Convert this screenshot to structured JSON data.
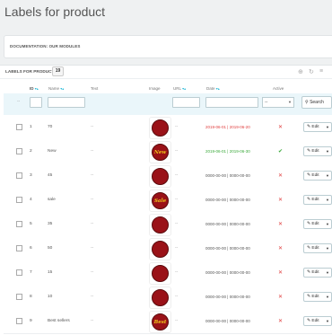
{
  "page": {
    "title": "Labels for product"
  },
  "doc_panel": {
    "label": "DOCUMENTATION: OUR MODULES"
  },
  "list": {
    "title": "LABELS FOR PRODUCT",
    "count": "19",
    "columns": {
      "id": "ID",
      "name": "Name",
      "text": "Text",
      "image": "Image",
      "url": "URL",
      "date": "Date",
      "active": "Active"
    },
    "filter": {
      "active_select": "--",
      "search_label": "Search"
    },
    "edit_label": "Edit",
    "rows": [
      {
        "id": "1",
        "name": "70",
        "text": "--",
        "date": "2019-06-01 | 2019-06-20",
        "date_color": "red",
        "active": "✕",
        "active_color": "#e04040",
        "badge": ""
      },
      {
        "id": "2",
        "name": "New",
        "text": "--",
        "date": "2019-06-01 | 2019-06-30",
        "date_color": "green",
        "active": "✔",
        "active_color": "#3aa93a",
        "badge": "New"
      },
      {
        "id": "3",
        "name": "45",
        "text": "--",
        "date": "0000-00-00 | 0000-00-00",
        "date_color": "",
        "active": "✕",
        "active_color": "#e04040",
        "badge": ""
      },
      {
        "id": "4",
        "name": "sale",
        "text": "--",
        "date": "0000-00-00 | 0000-00-00",
        "date_color": "",
        "active": "✕",
        "active_color": "#e04040",
        "badge": "Sale"
      },
      {
        "id": "5",
        "name": "35",
        "text": "--",
        "date": "0000-00-00 | 0000-00-00",
        "date_color": "",
        "active": "✕",
        "active_color": "#e04040",
        "badge": ""
      },
      {
        "id": "6",
        "name": "50",
        "text": "--",
        "date": "0000-00-00 | 0000-00-00",
        "date_color": "",
        "active": "✕",
        "active_color": "#e04040",
        "badge": ""
      },
      {
        "id": "7",
        "name": "15",
        "text": "--",
        "date": "0000-00-00 | 0000-00-00",
        "date_color": "",
        "active": "✕",
        "active_color": "#e04040",
        "badge": ""
      },
      {
        "id": "8",
        "name": "10",
        "text": "--",
        "date": "0000-00-00 | 0000-00-00",
        "date_color": "",
        "active": "✕",
        "active_color": "#e04040",
        "badge": ""
      },
      {
        "id": "9",
        "name": "Best sellers",
        "text": "--",
        "date": "0000-00-00 | 0000-00-00",
        "date_color": "",
        "active": "✕",
        "active_color": "#e04040",
        "badge": "Best"
      }
    ]
  },
  "icons": {
    "sort": "sort-arrows-icon",
    "refresh": "refresh-icon",
    "add": "add-icon",
    "database": "database-icon",
    "search": "search-icon",
    "edit": "pencil-icon"
  }
}
